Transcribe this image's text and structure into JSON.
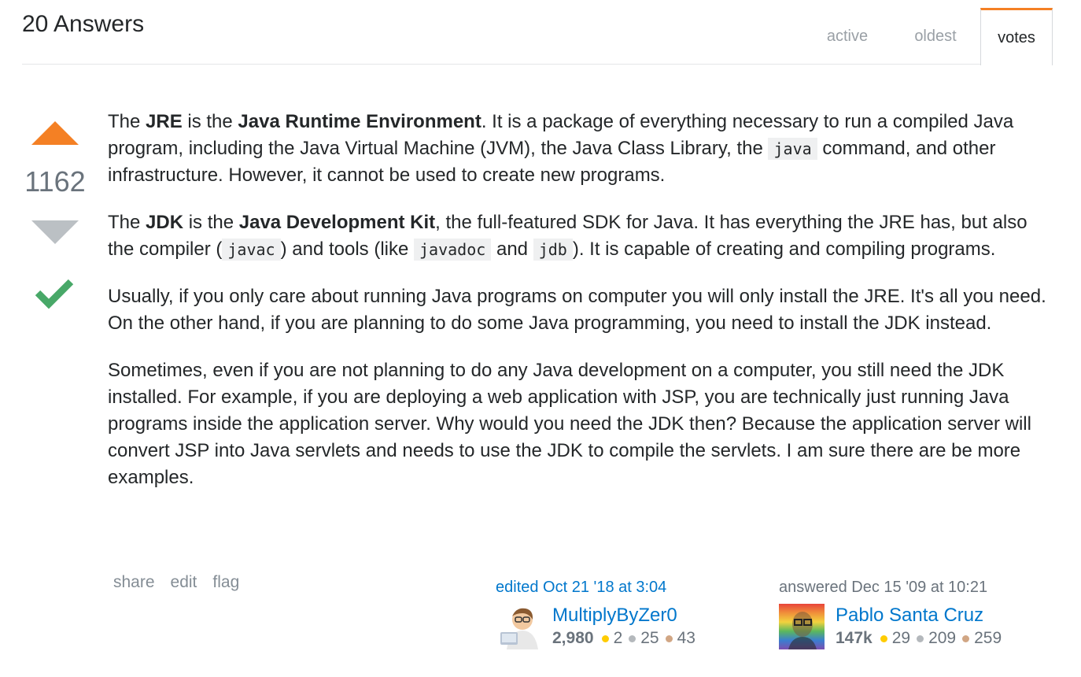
{
  "header": {
    "answers_count": "20 Answers",
    "tabs": [
      {
        "label": "active"
      },
      {
        "label": "oldest"
      },
      {
        "label": "votes"
      }
    ]
  },
  "vote": {
    "count": "1162",
    "accepted": true
  },
  "post": {
    "p1": {
      "s1": "The ",
      "b1": "JRE",
      "s2": " is the ",
      "b2": "Java Runtime Environment",
      "s3": ". It is a package of everything necessary to run a compiled Java program, including the Java Virtual Machine (JVM), the Java Class Library, the ",
      "c1": "java",
      "s4": " command, and other infrastructure. However, it cannot be used to create new programs."
    },
    "p2": {
      "s1": "The ",
      "b1": "JDK",
      "s2": " is the ",
      "b2": "Java Development Kit",
      "s3": ", the full-featured SDK for Java. It has everything the JRE has, but also the compiler (",
      "c1": "javac",
      "s4": ") and tools (like ",
      "c2": "javadoc",
      "s5": " and ",
      "c3": "jdb",
      "s6": "). It is capable of creating and compiling programs."
    },
    "p3": "Usually, if you only care about running Java programs on computer you will only install the JRE. It's all you need. On the other hand, if you are planning to do some Java programming, you need to install the JDK instead.",
    "p4": "Sometimes, even if you are not planning to do any Java development on a computer, you still need the JDK installed. For example, if you are deploying a web application with JSP, you are technically just running Java programs inside the application server. Why would you need the JDK then? Because the application server will convert JSP into Java servlets and needs to use the JDK to compile the servlets. I am sure there are be more examples."
  },
  "menu": {
    "share": "share",
    "edit": "edit",
    "flag": "flag"
  },
  "edited": {
    "action": "edited Oct 21 '18 at 3:04",
    "user": "MultiplyByZer0",
    "rep": "2,980",
    "gold": "2",
    "silver": "25",
    "bronze": "43"
  },
  "answered": {
    "action": "answered Dec 15 '09 at 10:21",
    "user": "Pablo Santa Cruz",
    "rep": "147k",
    "gold": "29",
    "silver": "209",
    "bronze": "259"
  },
  "colors": {
    "accent": "#f48024",
    "link": "#0077cc",
    "accepted": "#48a868",
    "vote_down": "#bbc0c4"
  }
}
